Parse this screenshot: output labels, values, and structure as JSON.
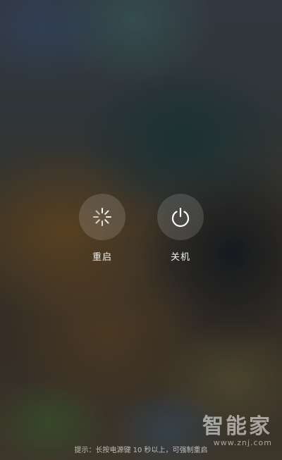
{
  "menu": {
    "reboot_label": "重启",
    "power_off_label": "关机",
    "reboot_icon": "loading-spinner-icon",
    "power_off_icon": "power-icon"
  },
  "hint": {
    "text": "提示：长按电源键 10 秒以上，可强制重启"
  },
  "watermark": {
    "title": "智能家",
    "url": "www.znj.com"
  },
  "colors": {
    "button_bg": "rgba(255,255,255,0.14)",
    "text": "#f2f2f2"
  }
}
